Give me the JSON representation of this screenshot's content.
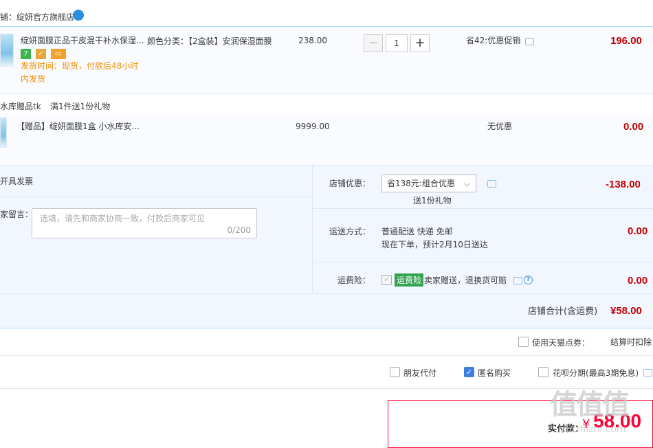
{
  "store": {
    "label": "铺：绽妍官方旗舰店"
  },
  "items": [
    {
      "title": "绽妍面膜正品干皮混干补水保湿...",
      "sku": "颜色分类：【2盒装】安润保湿面膜",
      "price": "238.00",
      "qty": "1",
      "promo": "省42:优惠促销",
      "subtotal": "196.00",
      "ship_note": "发货时间：现货，付款后48小时内发货"
    }
  ],
  "gift": {
    "header": "水库赠品tk",
    "rule": "满1件送1份礼物",
    "title": "【赠品】绽妍面膜1盒 小水库安...",
    "price": "9999.00",
    "promo": "无优惠",
    "subtotal": "0.00"
  },
  "summary": {
    "invoice_label": "开具发票",
    "message_label": "家留言：",
    "message_placeholder": "选填，请先和商家协商一致，付款后商家可见",
    "message_counter": "0/200",
    "store_discount_label": "店铺优惠：",
    "store_discount_value": "省138元:组合优惠",
    "store_discount_gift": "送1份礼物",
    "store_discount_amount": "-138.00",
    "shipping_label": "运送方式：",
    "shipping_value": "普通配送 快递 免邮",
    "shipping_eta": "现在下单，预计2月10日送达",
    "shipping_amount": "0.00",
    "insurance_label": "运费险：",
    "insurance_tag": "运费险",
    "insurance_desc": "卖家赠送，退换货可赔",
    "insurance_amount": "0.00",
    "total_label": "店铺合计(含运费)",
    "total_value": "¥58.00"
  },
  "tmall_points": {
    "label": "使用天猫点券：",
    "note": "结算时扣除"
  },
  "options": [
    {
      "label": "朋友代付",
      "checked": false
    },
    {
      "label": "匿名购买",
      "checked": true
    },
    {
      "label": "花呗分期(最高3期免息)",
      "checked": false
    }
  ],
  "payment": {
    "label": "实付款：",
    "currency": "¥",
    "amount": "58.00"
  },
  "watermark": {
    "main": "值值值",
    "sub": "zhizhizhi.com"
  }
}
